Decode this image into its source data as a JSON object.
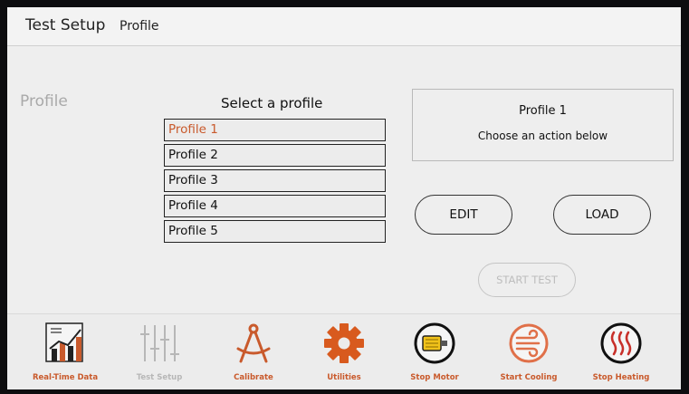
{
  "header": {
    "title": "Test Setup",
    "subtitle": "Profile"
  },
  "sidebar": {
    "title": "Profile"
  },
  "profiles": {
    "heading": "Select a profile",
    "items": [
      "Profile 1",
      "Profile 2",
      "Profile 3",
      "Profile 4",
      "Profile 5"
    ],
    "selected_index": 0
  },
  "info": {
    "title": "Profile 1",
    "message": "Choose an action below"
  },
  "actions": {
    "edit_label": "EDIT",
    "load_label": "LOAD",
    "start_label": "START TEST",
    "start_enabled": false
  },
  "toolbar": {
    "items": [
      {
        "label": "Real-Time Data",
        "icon": "chart-icon",
        "enabled": true
      },
      {
        "label": "Test Setup",
        "icon": "sliders-icon",
        "enabled": false
      },
      {
        "label": "Calibrate",
        "icon": "compass-icon",
        "enabled": true
      },
      {
        "label": "Utilities",
        "icon": "gear-icon",
        "enabled": true
      },
      {
        "label": "Stop Motor",
        "icon": "motor-icon",
        "enabled": true
      },
      {
        "label": "Start Cooling",
        "icon": "cooling-icon",
        "enabled": true
      },
      {
        "label": "Stop Heating",
        "icon": "heating-icon",
        "enabled": true
      }
    ]
  },
  "colors": {
    "accent": "#c95a2c",
    "disabled": "#b7b7b7",
    "background": "#eeeeee",
    "motor_yellow": "#f0c21a"
  }
}
